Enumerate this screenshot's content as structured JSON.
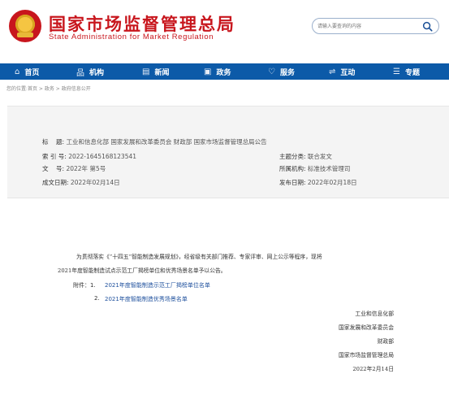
{
  "header": {
    "title": "国家市场监督管理总局",
    "subtitle": "State Administration for Market Regulation",
    "search_placeholder": "请输入要查询的内容"
  },
  "nav": [
    {
      "label": "首页",
      "icon": "home-icon",
      "glyph": "⌂"
    },
    {
      "label": "机构",
      "icon": "org-chart-icon",
      "glyph": "品"
    },
    {
      "label": "新闻",
      "icon": "news-icon",
      "glyph": "▤"
    },
    {
      "label": "政务",
      "icon": "government-icon",
      "glyph": "▣"
    },
    {
      "label": "服务",
      "icon": "heart-icon",
      "glyph": "♡"
    },
    {
      "label": "互动",
      "icon": "exchange-icon",
      "glyph": "⇌"
    },
    {
      "label": "专题",
      "icon": "list-icon",
      "glyph": "☰"
    }
  ],
  "breadcrumb": "您的位置:首页 > 政务 > 政府信息公开",
  "info": {
    "title_label": "标    题:",
    "title_value": "工业和信息化部 国家发展和改革委员会 财政部 国家市场监督管理总局公告",
    "index_label": "索 引 号:",
    "index_value": "2022-1645168123541",
    "topic_label": "主题分类:",
    "topic_value": "联合发文",
    "docno_label": "文    号:",
    "docno_value": "2022年 第5号",
    "org_label": "所属机构:",
    "org_value": "标准技术管理司",
    "date_label": "成文日期:",
    "date_value": "2022年02月14日",
    "pub_label": "发布日期:",
    "pub_value": "2022年02月18日"
  },
  "article": {
    "line1": "为贯彻落实《“十四五”智能制造发展规划》，经省级有关部门推荐、专家评审、网上公示等程序，现将",
    "line2": "2021年度智能制造试点示范工厂揭榜单位和优秀场景名单予以公告。",
    "attachment_label": "附件：1.",
    "attachment1": "2021年度智能制造示范工厂揭榜单位名单",
    "attachment2_num": "2.",
    "attachment2": "2021年度智能制造优秀场景名单",
    "signers": [
      "工业和信息化部",
      "国家发展和改革委员会",
      "财政部",
      "国家市场监督管理总局"
    ],
    "date": "2022年2月14日"
  }
}
